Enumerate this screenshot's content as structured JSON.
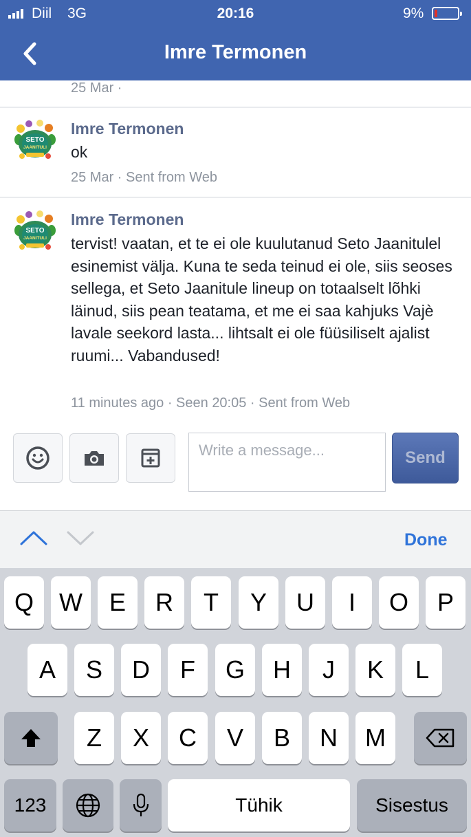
{
  "status_bar": {
    "carrier": "Diil",
    "network": "3G",
    "time": "20:16",
    "battery": "9%"
  },
  "header": {
    "back_icon": "chevron-left-icon",
    "title": "Imre Termonen"
  },
  "previous_message": {
    "timestamp": "25 Mar ·"
  },
  "messages": [
    {
      "sender": "Imre Termonen",
      "text": "ok",
      "meta": "25 Mar · Sent from Web"
    },
    {
      "sender": "Imre Termonen",
      "text": "tervist! vaatan, et te ei ole kuulutanud Seto Jaanitulel esinemist välja. Kuna te seda teinud ei ole, siis seoses sellega, et Seto Jaanitule lineup on totaalselt lõhki läinud, siis pean teatama, et me ei saa kahjuks Vajè lavale seekord lasta... lihtsalt ei ole füüsiliselt ajalist ruumi... Vabandused!",
      "meta": "11 minutes ago · Seen 20:05 · Sent from Web"
    }
  ],
  "avatar": {
    "line1": "SETO",
    "line2": "JAANITULI"
  },
  "composer": {
    "emoji_icon": "smiley-icon",
    "camera_icon": "camera-icon",
    "sticker_icon": "add-sticker-icon",
    "placeholder": "Write a message...",
    "send_label": "Send"
  },
  "keyboard_bar": {
    "up_icon": "chevron-up-icon",
    "down_icon": "chevron-down-icon",
    "done_label": "Done"
  },
  "keyboard": {
    "row1": [
      "Q",
      "W",
      "E",
      "R",
      "T",
      "Y",
      "U",
      "I",
      "O",
      "P"
    ],
    "row2": [
      "A",
      "S",
      "D",
      "F",
      "G",
      "H",
      "J",
      "K",
      "L"
    ],
    "row3": [
      "Z",
      "X",
      "C",
      "V",
      "B",
      "N",
      "M"
    ],
    "shift_icon": "shift-icon",
    "backspace_icon": "backspace-icon",
    "numbers_label": "123",
    "globe_icon": "globe-icon",
    "mic_icon": "microphone-icon",
    "space_label": "Tühik",
    "return_label": "Sisestus"
  },
  "colors": {
    "header_bg": "#4065b0",
    "link_blue": "#2f73d9",
    "sender_name": "#5b6a8c",
    "battery_low": "#e0322a"
  }
}
